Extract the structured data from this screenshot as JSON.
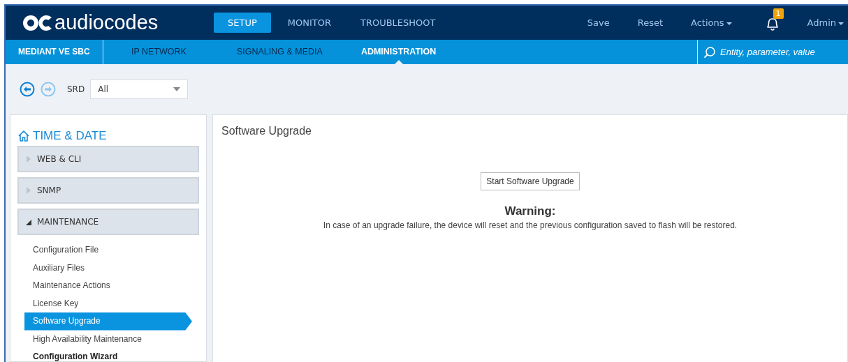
{
  "header": {
    "brand": "audiocodes",
    "tabs": [
      {
        "label": "SETUP",
        "selected": true
      },
      {
        "label": "MONITOR",
        "selected": false
      },
      {
        "label": "TROUBLESHOOT",
        "selected": false
      }
    ],
    "actions": [
      {
        "label": "Save",
        "kind": "plain"
      },
      {
        "label": "Reset",
        "kind": "plain"
      },
      {
        "label": "Actions",
        "kind": "menu"
      }
    ],
    "notifications": {
      "count": "1"
    },
    "user": {
      "label": "Admin"
    }
  },
  "subnav": {
    "product": "MEDIANT VE SBC",
    "tabs": [
      {
        "label": "IP NETWORK",
        "selected": false
      },
      {
        "label": "SIGNALING & MEDIA",
        "selected": false
      },
      {
        "label": "ADMINISTRATION",
        "selected": true
      }
    ],
    "search": {
      "placeholder": "Entity, parameter, value"
    }
  },
  "toolbar": {
    "srd_label": "SRD",
    "srd_value": "All"
  },
  "sidebar": {
    "title": "TIME & DATE",
    "groups": [
      {
        "label": "WEB & CLI",
        "expanded": false
      },
      {
        "label": "SNMP",
        "expanded": false
      },
      {
        "label": "MAINTENANCE",
        "expanded": true,
        "children": [
          {
            "label": "Configuration File",
            "selected": false,
            "bold": false
          },
          {
            "label": "Auxiliary Files",
            "selected": false,
            "bold": false
          },
          {
            "label": "Maintenance Actions",
            "selected": false,
            "bold": false
          },
          {
            "label": "License Key",
            "selected": false,
            "bold": false
          },
          {
            "label": "Software Upgrade",
            "selected": true,
            "bold": false
          },
          {
            "label": "High Availability Maintenance",
            "selected": false,
            "bold": false
          },
          {
            "label": "Configuration Wizard",
            "selected": false,
            "bold": true
          }
        ]
      }
    ]
  },
  "main": {
    "title": "Software Upgrade",
    "button": "Start Software Upgrade",
    "warning_title": "Warning:",
    "warning_text": "In case of an upgrade failure, the device will reset and the previous configuration saved to flash will be restored."
  }
}
